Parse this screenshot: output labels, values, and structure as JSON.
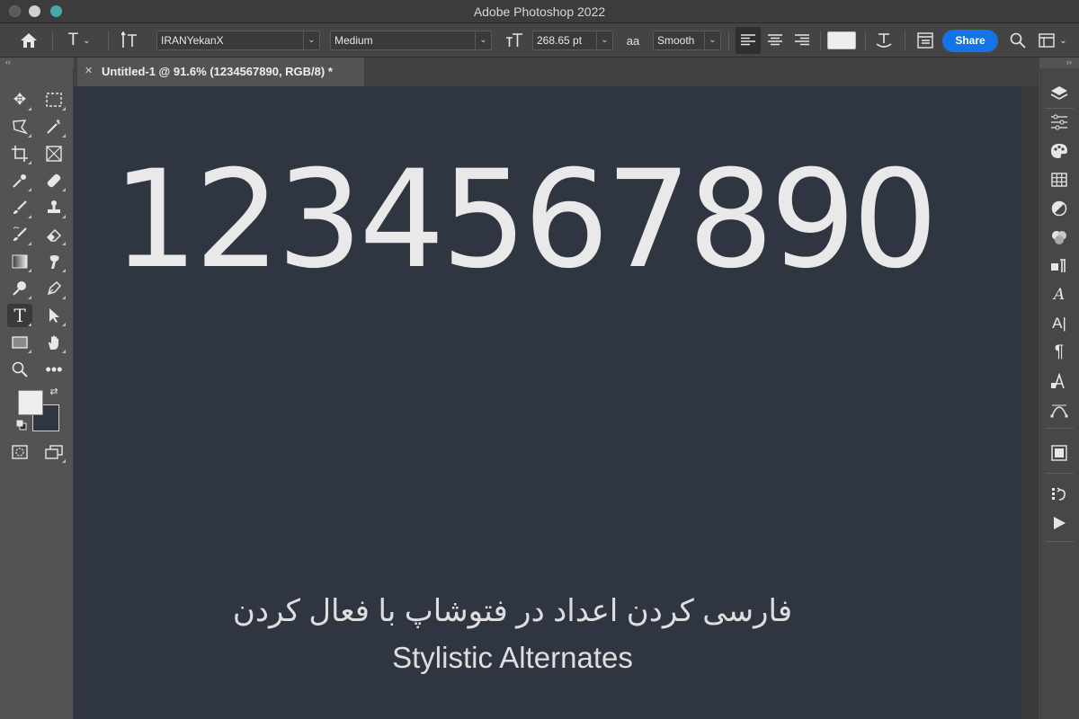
{
  "window": {
    "title": "Adobe Photoshop 2022"
  },
  "options_bar": {
    "font_family": "IRANYekanX",
    "font_style": "Medium",
    "font_size": "268.65 pt",
    "aa_label": "aa",
    "anti_alias": "Smooth",
    "share_label": "Share",
    "text_color": "#eeeeee"
  },
  "document": {
    "tab_title": "Untitled-1 @ 91.6% (1234567890, RGB/8) *",
    "canvas_color": "#2f3641",
    "big_text": "1234567890",
    "caption_fa": "فارسی کردن اعداد در فتوشاپ با فعال کردن",
    "caption_en": "Stylistic Alternates"
  },
  "swatches": {
    "foreground": "#eeeeee",
    "background": "#2f3641"
  },
  "accent": "#1473e6"
}
